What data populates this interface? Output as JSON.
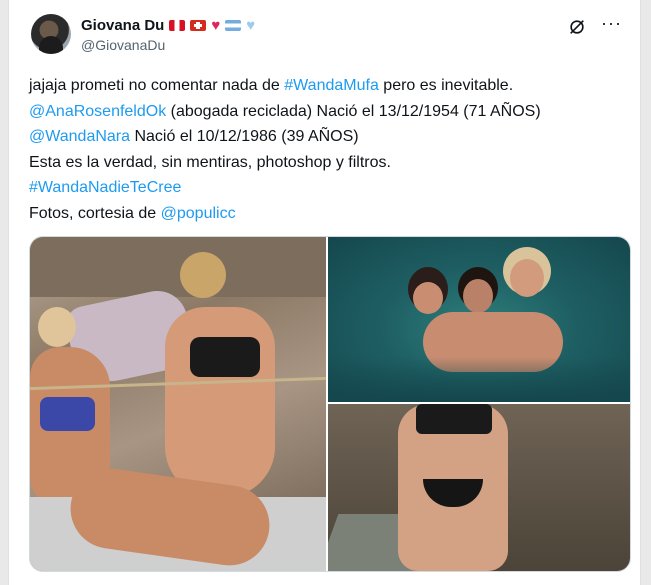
{
  "author": {
    "name": "Giovana Du",
    "handle": "@GiovanaDu"
  },
  "post": {
    "line1_a": "jajaja prometi no comentar nada de ",
    "line1_tag": "#WandaMufa",
    "line1_b": " pero es inevitable.",
    "line2_mention": "@AnaRosenfeldOk",
    "line2_b": " (abogada reciclada) Nació el 13/12/1954 (71 AÑOS)",
    "line3_mention": "@WandaNara",
    "line3_b": " Nació el 10/12/1986 (39 AÑOS)",
    "line4": "Esta es la verdad, sin mentiras, photoshop y filtros.",
    "line5_tag": "#WandaNadieTeCree",
    "line6_a": "Fotos, cortesia de ",
    "line6_mention": "@populicc"
  },
  "icons": {
    "more": "more-options-icon",
    "grok": "grok-icon"
  },
  "colors": {
    "link": "#1d9bf0",
    "text": "#0f1419",
    "muted": "#536471"
  }
}
